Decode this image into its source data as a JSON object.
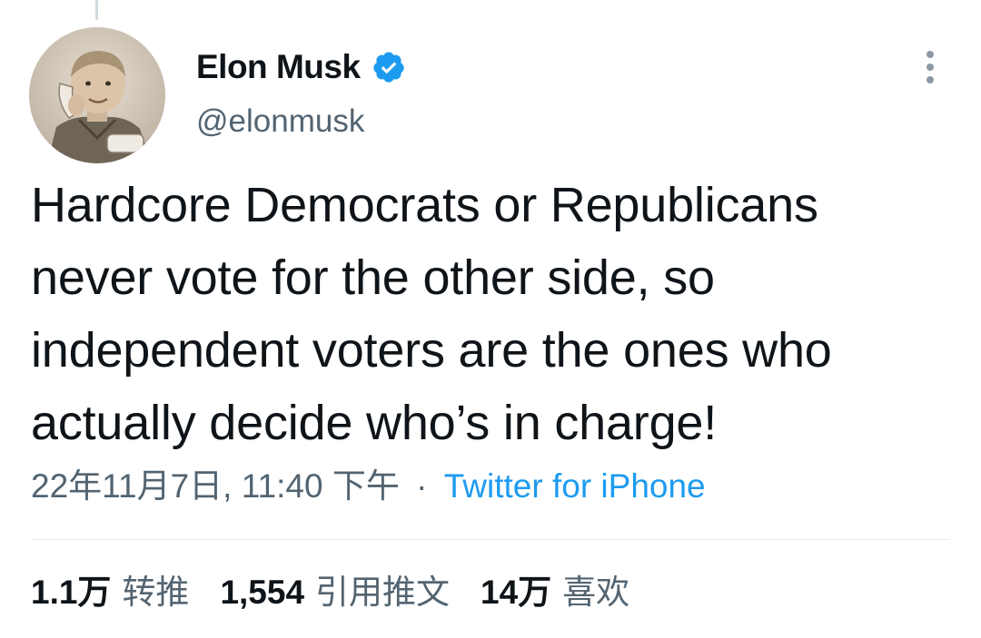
{
  "tweet": {
    "author": {
      "display_name": "Elon Musk",
      "handle": "@elonmusk",
      "verified_icon": "verified-badge-icon",
      "avatar": "avatar-image"
    },
    "text": "Hardcore Democrats or Republicans\nnever vote for the other side, so\nindependent voters are the ones who\nactually decide who’s in charge!",
    "timestamp": "22年11月7日, 11:40 下午",
    "separator": "·",
    "source": "Twitter for iPhone",
    "more_icon": "more-options-icon"
  },
  "stats": {
    "retweets": {
      "count": "1.1万",
      "label": "转推"
    },
    "quotes": {
      "count": "1,554",
      "label": "引用推文"
    },
    "likes": {
      "count": "14万",
      "label": "喜欢"
    }
  },
  "colors": {
    "text_primary": "#0f1419",
    "text_secondary": "#536471",
    "accent": "#1d9bf0",
    "divider": "#e6ecf0"
  }
}
